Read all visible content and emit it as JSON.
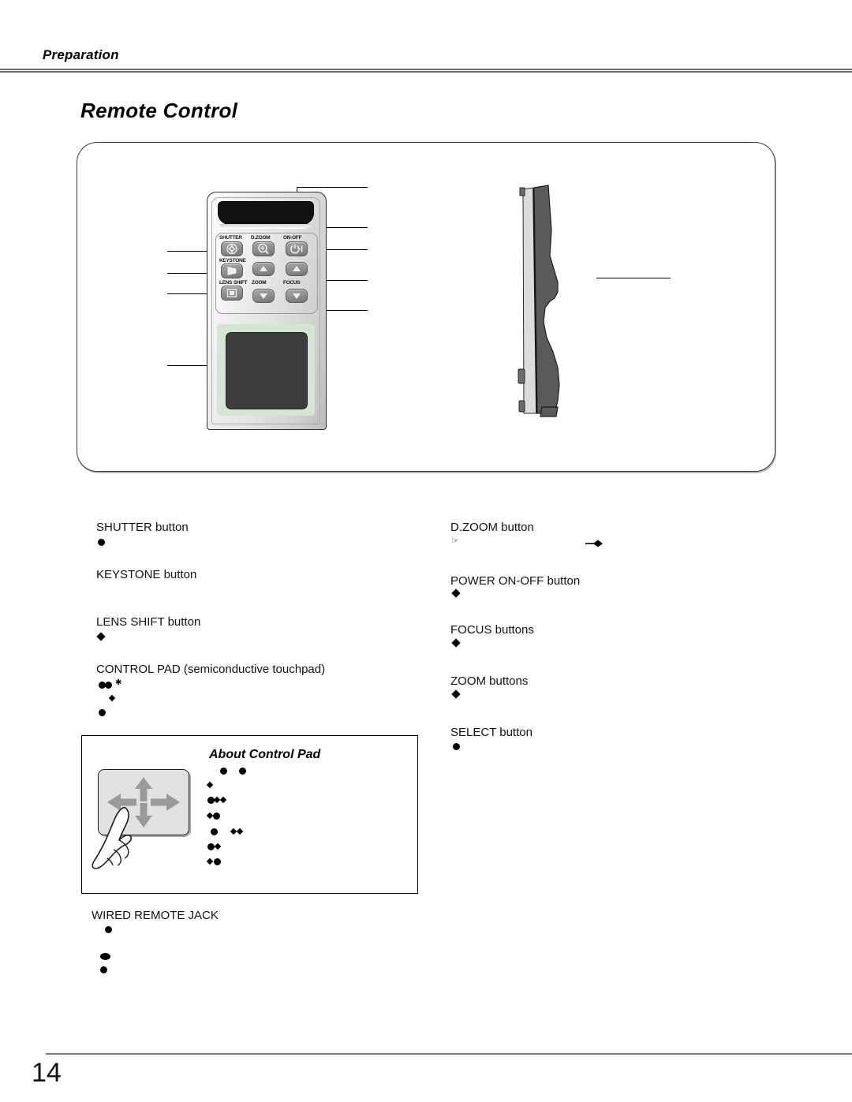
{
  "header": {
    "chapter": "Preparation"
  },
  "section": {
    "heading": "Remote Control"
  },
  "remote_front": {
    "labels": {
      "shutter": "SHUTTER",
      "dzoom": "D.ZOOM",
      "onoff": "ON-OFF",
      "keystone": "KEYSTONE",
      "lens_shift": "LENS SHIFT",
      "zoom": "ZOOM",
      "focus": "FOCUS"
    },
    "icons": {
      "shutter": "iris-shutter-icon",
      "dzoom": "magnifier-plus-icon",
      "onoff": "power-icon",
      "keystone": "keystone-trapezoid-icon",
      "lens_shift": "lens-shift-frame-icon",
      "zoom_up": "triangle-up-icon",
      "zoom_down": "triangle-down-icon",
      "focus_up": "triangle-up-icon",
      "focus_down": "triangle-down-icon",
      "control_pad": "control-pad-icon",
      "emitter": "infrared-emitter-icon"
    }
  },
  "callouts": {
    "left": [
      {
        "label": "SHUTTER button"
      },
      {
        "label": "KEYSTONE button"
      },
      {
        "label": "LENS SHIFT button"
      },
      {
        "label": "CONTROL PAD (semiconductive touchpad)"
      }
    ],
    "right": [
      {
        "label": "D.ZOOM button"
      },
      {
        "label": "POWER ON-OFF button"
      },
      {
        "label": "FOCUS buttons"
      },
      {
        "label": "ZOOM buttons"
      },
      {
        "label": "SELECT button"
      }
    ],
    "bottom": [
      {
        "label": "WIRED REMOTE JACK"
      }
    ]
  },
  "about_control_pad": {
    "title": "About Control Pad",
    "pad_icon": "touchpad-four-arrows-icon",
    "hand_icon": "pointing-finger-icon"
  },
  "footer": {
    "page_number": "14"
  },
  "colors": {
    "rule": "#6e6e6e",
    "pad_surround": "#d6e4d6",
    "pad_surface": "#3d3d3d",
    "button_face": "#8d8d8d",
    "side_body": "#5a5a5a",
    "side_edge": "#d8d8d8"
  }
}
